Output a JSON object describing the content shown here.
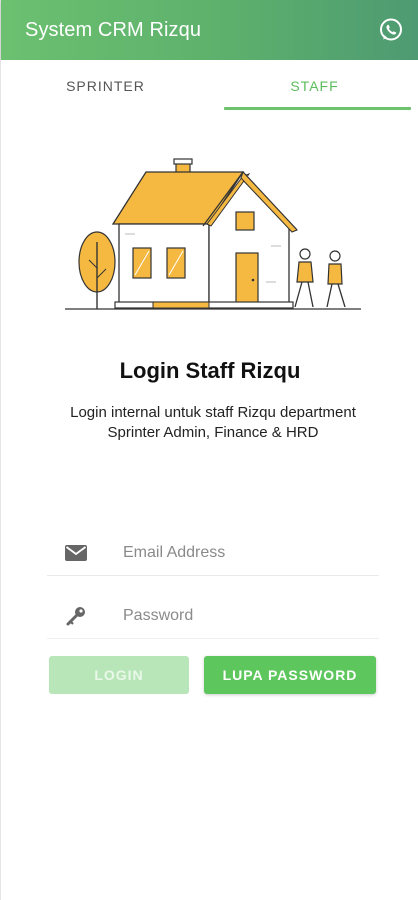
{
  "app": {
    "title": "System CRM Rizqu"
  },
  "appbar": {
    "action_icon": "whatsapp-icon"
  },
  "tabs": [
    {
      "label": "SPRINTER",
      "active": false
    },
    {
      "label": "STAFF",
      "active": true
    }
  ],
  "colors": {
    "primary": "#5cbc5c",
    "header_start": "#6cc070",
    "header_end": "#4e9a72",
    "house_accent": "#f5b942"
  },
  "login": {
    "heading": "Login Staff Rizqu",
    "description": "Login internal untuk staff Rizqu department Sprinter Admin, Finance & HRD",
    "email_placeholder": "Email Address",
    "password_placeholder": "Password",
    "email_icon": "envelope-icon",
    "password_icon": "key-icon"
  },
  "buttons": {
    "login_label": "LOGIN",
    "forgot_label": "LUPA PASSWORD"
  }
}
